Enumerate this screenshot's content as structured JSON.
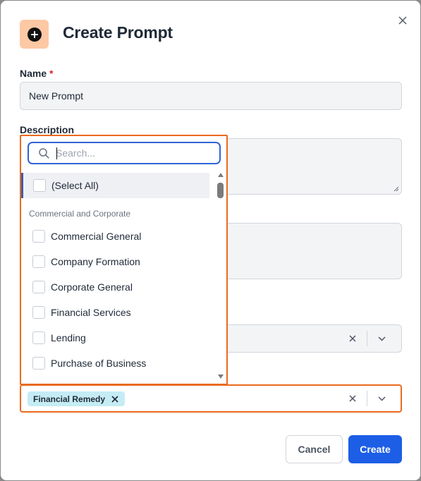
{
  "modal": {
    "title": "Create Prompt",
    "header_icon": "plus-circle-icon",
    "close_icon": "close-icon"
  },
  "form": {
    "name": {
      "label": "Name",
      "required_mark": "*",
      "value": "New Prompt"
    },
    "description": {
      "label": "Description",
      "value": ""
    },
    "tags_select": {
      "selected_chip": "Financial Remedy"
    }
  },
  "dropdown": {
    "search_placeholder": "Search...",
    "select_all_label": "(Select All)",
    "group_header": "Commercial and Corporate",
    "options": [
      "Commercial General",
      "Company Formation",
      "Corporate General",
      "Financial Services",
      "Lending",
      "Purchase of Business"
    ]
  },
  "footer": {
    "cancel_label": "Cancel",
    "create_label": "Create"
  },
  "colors": {
    "accent_orange": "#ea6a1f",
    "primary_blue": "#1d5ee6",
    "chip_bg": "#c5ecf4",
    "header_icon_bg": "#fdc8a4"
  }
}
